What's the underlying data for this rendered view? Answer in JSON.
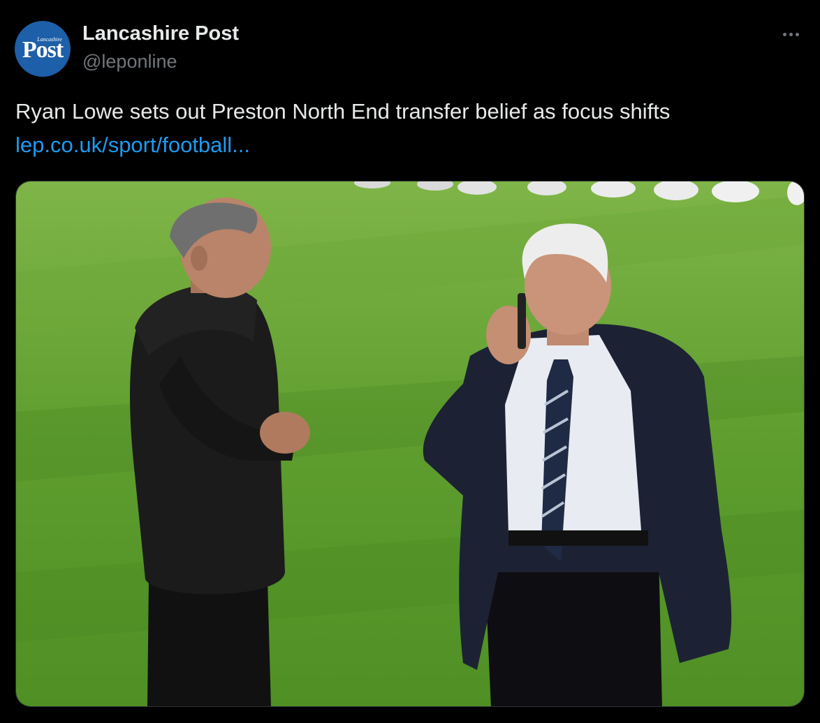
{
  "author": {
    "display_name": "Lancashire Post",
    "handle": "@leponline",
    "avatar_logo_small": "Lancashire",
    "avatar_logo_main": "Post"
  },
  "tweet": {
    "text": "Ryan Lowe sets out Preston North End transfer belief as focus shifts",
    "link": "lep.co.uk/sport/football..."
  },
  "icons": {
    "more": "more-horizontal-icon"
  },
  "colors": {
    "background": "#000000",
    "text_primary": "#e7e9ea",
    "text_secondary": "#71767b",
    "link": "#1d9bf0",
    "avatar_bg": "#1d5fa8",
    "pitch_green": "#5e9d2e"
  }
}
